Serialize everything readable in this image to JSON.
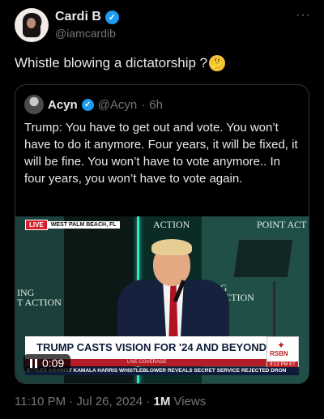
{
  "tweet": {
    "author_name": "Cardi B",
    "author_handle": "@iamcardib",
    "more_label": "···",
    "text": "Whistle blowing a dictatorship ?",
    "emoji": "thinking-face-emoji"
  },
  "quote": {
    "author_name": "Acyn",
    "author_handle": "@Acyn",
    "separator": "·",
    "age": "6h",
    "text": "Trump: You have to get out and vote. You won’t have to do it anymore. Four years, it will be fixed, it will be fine. You won’t have to vote anymore.. In four years, you won’t have to vote again."
  },
  "video": {
    "live_label": "LIVE",
    "location": "WEST PALM BEACH, FL",
    "bg_text_left": "ING\nT ACTION",
    "bg_text_right": "ING\nT ACTION",
    "bg_text_top": "ACTION",
    "bg_text_top_right": "POINT ACT",
    "headline": "TRUMP CASTS VISION FOR '24 AND BEYOND",
    "coverage_label": "LIVE COVERAGE",
    "ticker": "ETTLES AGAINST KAMALA HARRIS   WHISTLEBLOWER REVEALS SECRET SERVICE REJECTED DRON",
    "network": "RSBN",
    "network_time": "9:12 PM ET",
    "elapsed": "0:09"
  },
  "footer": {
    "timestamp": "11:10 PM · Jul 26, 2024 · ",
    "views_count": "1M",
    "views_label": " Views"
  },
  "colors": {
    "verified": "#1d9bf0",
    "background": "#000000",
    "secondary_text": "#71767b",
    "live_red": "#d4202a"
  }
}
